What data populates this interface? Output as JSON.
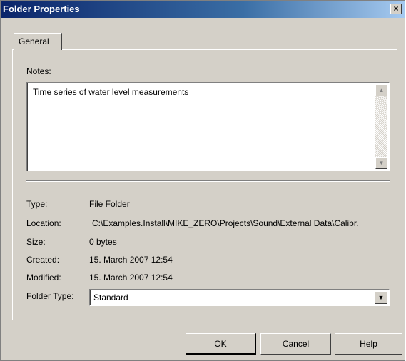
{
  "window": {
    "title": "Folder Properties",
    "close_label": "×"
  },
  "tabs": [
    {
      "label": "General",
      "selected": true
    }
  ],
  "notes": {
    "label": "Notes:",
    "value": "Time series of water level measurements",
    "scroll_up": "▲",
    "scroll_down": "▼"
  },
  "properties": [
    {
      "label": "Type:",
      "value": "File Folder"
    },
    {
      "label": "Location:",
      "value": "C:\\Examples.Install\\MIKE_ZERO\\Projects\\Sound\\External Data\\Calibr."
    },
    {
      "label": "Size:",
      "value": "0 bytes"
    },
    {
      "label": "Created:",
      "value": "15. March 2007 12:54"
    },
    {
      "label": "Modified:",
      "value": "15. March 2007 12:54"
    }
  ],
  "folder_type": {
    "label": "Folder Type:",
    "selected": "Standard",
    "arrow": "▼"
  },
  "buttons": {
    "ok": "OK",
    "cancel": "Cancel",
    "help": "Help"
  }
}
